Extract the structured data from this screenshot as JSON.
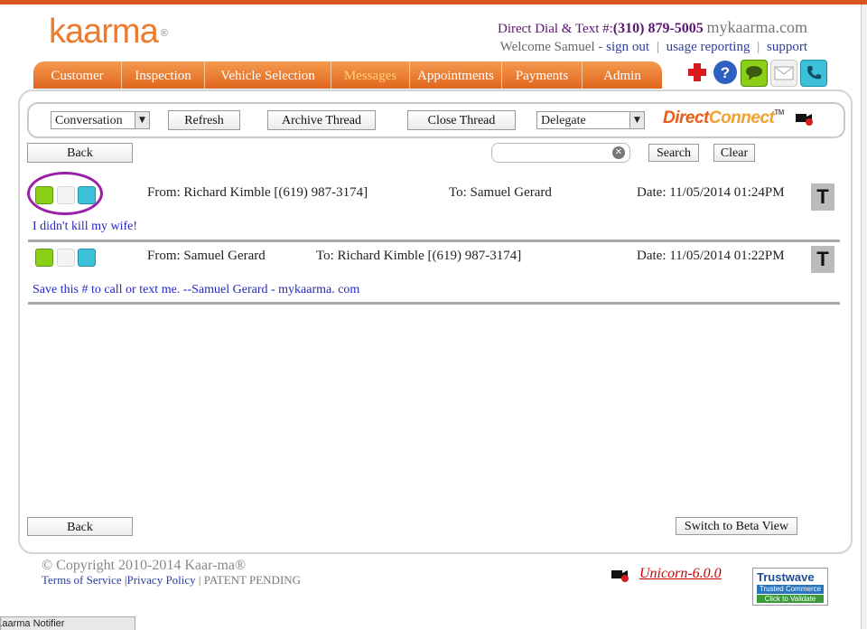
{
  "brand": {
    "logo_text": "kaarma",
    "logo_mark": "®"
  },
  "header": {
    "dial_label": "Direct Dial & Text #:",
    "phone": "(310) 879-5005",
    "site": "mykaarma.com",
    "welcome": "Welcome Samuel -",
    "sign_out": "sign out",
    "usage_reporting": "usage reporting",
    "support": "support",
    "separator": "|"
  },
  "nav": {
    "tabs": [
      {
        "label": "Customer"
      },
      {
        "label": "Inspection"
      },
      {
        "label": "Vehicle Selection"
      },
      {
        "label": "Messages",
        "active": true
      },
      {
        "label": "Appointments"
      },
      {
        "label": "Payments"
      },
      {
        "label": "Admin"
      }
    ]
  },
  "header_icons": [
    "red-cross-icon",
    "help-icon",
    "text-icon",
    "email-icon",
    "call-icon"
  ],
  "toolbar": {
    "conversation": "Conversation",
    "refresh": "Refresh",
    "archive": "Archive Thread",
    "close": "Close Thread",
    "delegate": "Delegate",
    "direct": "Direct",
    "connect": "Connect",
    "tm": "TM"
  },
  "actions": {
    "back": "Back",
    "search": "Search",
    "clear": "Clear",
    "beta": "Switch to Beta View",
    "search_value": ""
  },
  "messages": [
    {
      "from": "From: Richard Kimble [(619) 987-3174]",
      "to": "To: Samuel Gerard",
      "date": "Date: 11/05/2014 01:24PM",
      "body": "I didn't kill my wife!",
      "badge": "T"
    },
    {
      "from": "From: Samuel Gerard",
      "to": "To: Richard Kimble [(619) 987-3174]",
      "date": "Date: 11/05/2014 01:22PM",
      "body": "Save this # to call or text me. --Samuel Gerard - mykaarma. com",
      "badge": "T"
    }
  ],
  "footer": {
    "copyright": "© Copyright 2010-2014 Kaar-ma®",
    "terms": "Terms of Service",
    "privacy": "|Privacy Policy",
    "sep": "|",
    "patent": "PATENT PENDING",
    "version": "Unicorn-6.0.0",
    "trust_title": "Trustwave",
    "trust_sub": "Trusted Commerce",
    "trust_cta": "Click to Validate"
  },
  "taskbar": {
    "notifier": "Kaarma Notifier"
  },
  "colors": {
    "accent": "#e0651c",
    "link": "#2c3f99",
    "purple": "#5a1670",
    "highlight": "#9b1fa8"
  }
}
